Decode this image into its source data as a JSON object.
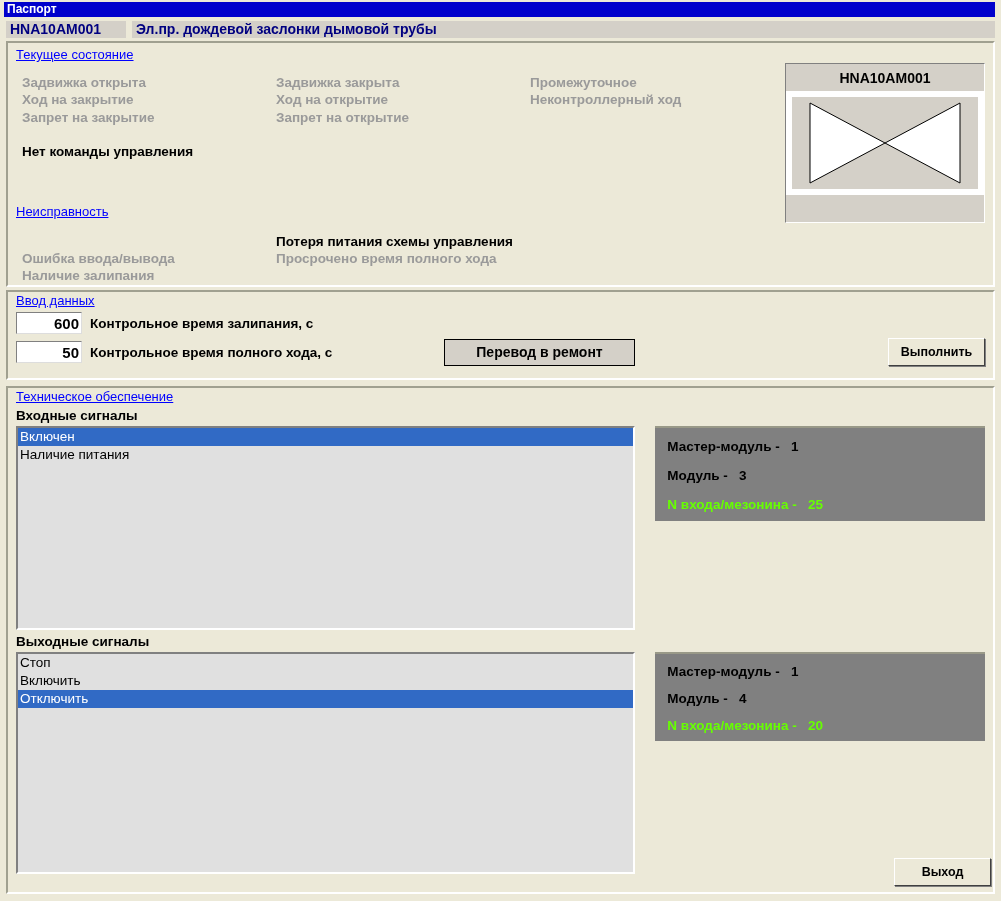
{
  "window": {
    "title": "Паспорт"
  },
  "header": {
    "code": "HNA10AM001",
    "description": "Эл.пр. дождевой заслонки дымовой трубы"
  },
  "state": {
    "title": "Текущее состояние",
    "columns": [
      {
        "items": [
          {
            "label": "Задвижка открыта",
            "active": false
          },
          {
            "label": "Ход на закрытие",
            "active": false
          },
          {
            "label": "Запрет на закрытие",
            "active": false
          }
        ]
      },
      {
        "items": [
          {
            "label": "Задвижка закрыта",
            "active": false
          },
          {
            "label": "Ход на открытие",
            "active": false
          },
          {
            "label": "Запрет на открытие",
            "active": false
          }
        ]
      },
      {
        "items": [
          {
            "label": "Промежуточное",
            "active": false
          },
          {
            "label": "Неконтроллерный ход",
            "active": false
          }
        ]
      }
    ],
    "command": {
      "label": "Нет команды управления",
      "active": true
    },
    "symbol": {
      "title": "HNA10AM001"
    }
  },
  "fault": {
    "title": "Неисправность",
    "columns": [
      {
        "items": [
          {
            "label": "Ошибка ввода/вывода",
            "active": false
          },
          {
            "label": "Наличие залипания",
            "active": false
          }
        ]
      },
      {
        "items": [
          {
            "label": "Потеря питания схемы управления",
            "active": true
          },
          {
            "label": "Просрочено время полного хода",
            "active": false
          }
        ]
      }
    ]
  },
  "input": {
    "title": "Ввод данных",
    "fields": [
      {
        "value": "600",
        "label": "Контрольное время залипания, с"
      },
      {
        "value": "50",
        "label": "Контрольное время полного хода, с"
      }
    ],
    "repair_button": "Перевод в ремонт",
    "execute_button": "Выполнить"
  },
  "tech": {
    "title": "Техническое обеспечение",
    "groups": [
      {
        "title": "Входные сигналы",
        "items": [
          {
            "label": "Включен",
            "selected": true
          },
          {
            "label": "Наличие питания",
            "selected": false
          }
        ],
        "info": [
          {
            "label": "Мастер-модуль -",
            "value": "1",
            "color": "#000000"
          },
          {
            "label": "Модуль -",
            "value": "3",
            "color": "#000000"
          },
          {
            "label": "N входа/мезонина -",
            "value": "25",
            "color": "#66ff00"
          }
        ]
      },
      {
        "title": "Выходные сигналы",
        "items": [
          {
            "label": "Стоп",
            "selected": false
          },
          {
            "label": "Включить",
            "selected": false
          },
          {
            "label": "Отключить",
            "selected": true
          }
        ],
        "info": [
          {
            "label": "Мастер-модуль -",
            "value": "1",
            "color": "#000000"
          },
          {
            "label": "Модуль -",
            "value": "4",
            "color": "#000000"
          },
          {
            "label": "N входа/мезонина -",
            "value": "20",
            "color": "#66ff00"
          }
        ]
      }
    ],
    "exit_button": "Выход"
  }
}
